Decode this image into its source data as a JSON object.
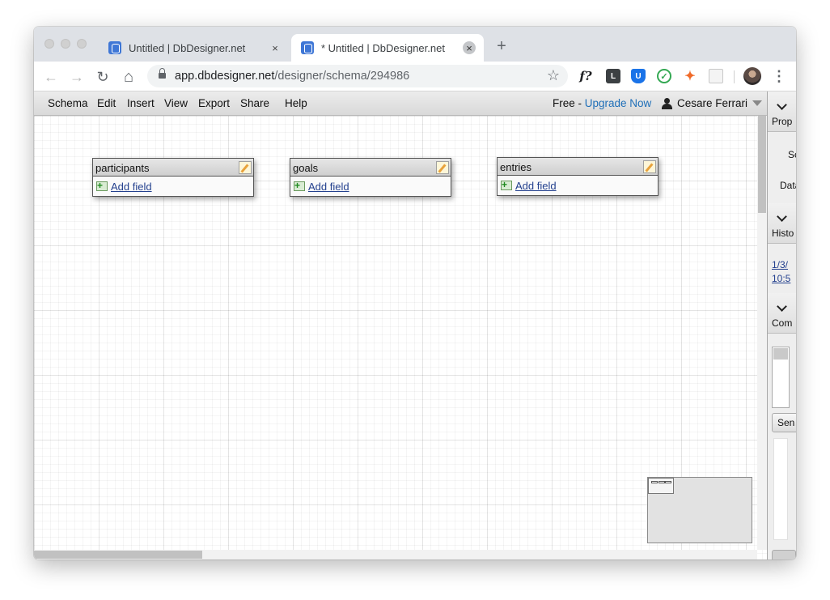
{
  "browser": {
    "tabs": [
      {
        "title": "Untitled | DbDesigner.net",
        "active": false
      },
      {
        "title": "* Untitled | DbDesigner.net",
        "active": true
      }
    ],
    "close_glyph": "×",
    "new_tab_glyph": "+",
    "url_host": "app.dbdesigner.net",
    "url_path": "/designer/schema/294986",
    "back_glyph": "←",
    "forward_glyph": "→",
    "reload_glyph": "↻",
    "home_glyph": "⌂",
    "star_glyph": "☆",
    "menu_glyph": "⋮",
    "extensions": [
      {
        "name": "function-extension-icon",
        "glyph": "f?"
      },
      {
        "name": "lastpass-extension-icon",
        "glyph": "L"
      },
      {
        "name": "shield-extension-icon",
        "glyph": "U"
      },
      {
        "name": "check-extension-icon",
        "glyph": "✓"
      },
      {
        "name": "bird-extension-icon",
        "glyph": "✦"
      },
      {
        "name": "grid-extension-icon",
        "glyph": ""
      }
    ]
  },
  "menubar": {
    "items": [
      "Schema",
      "Edit",
      "Insert",
      "View",
      "Export",
      "Share",
      "Help"
    ],
    "plan_label": "Free - ",
    "upgrade_label": "Upgrade Now",
    "user_name": "Cesare Ferrari"
  },
  "canvas": {
    "tables": [
      {
        "name": "participants",
        "add_field_label": "Add field"
      },
      {
        "name": "goals",
        "add_field_label": "Add field"
      },
      {
        "name": "entries",
        "add_field_label": "Add field"
      }
    ]
  },
  "sidepanel": {
    "properties_label": "Prop",
    "schema_fragment": "Sc",
    "database_fragment": "Data",
    "history_label": "Histo",
    "history_link_line1": "1/3/",
    "history_link_line2": "10:5",
    "comments_label": "Com",
    "send_label": "Sen"
  },
  "colors": {
    "upgrade_link": "#1f6fb8",
    "tab_strip": "#dee1e6",
    "favicon": "#3f77d6"
  }
}
